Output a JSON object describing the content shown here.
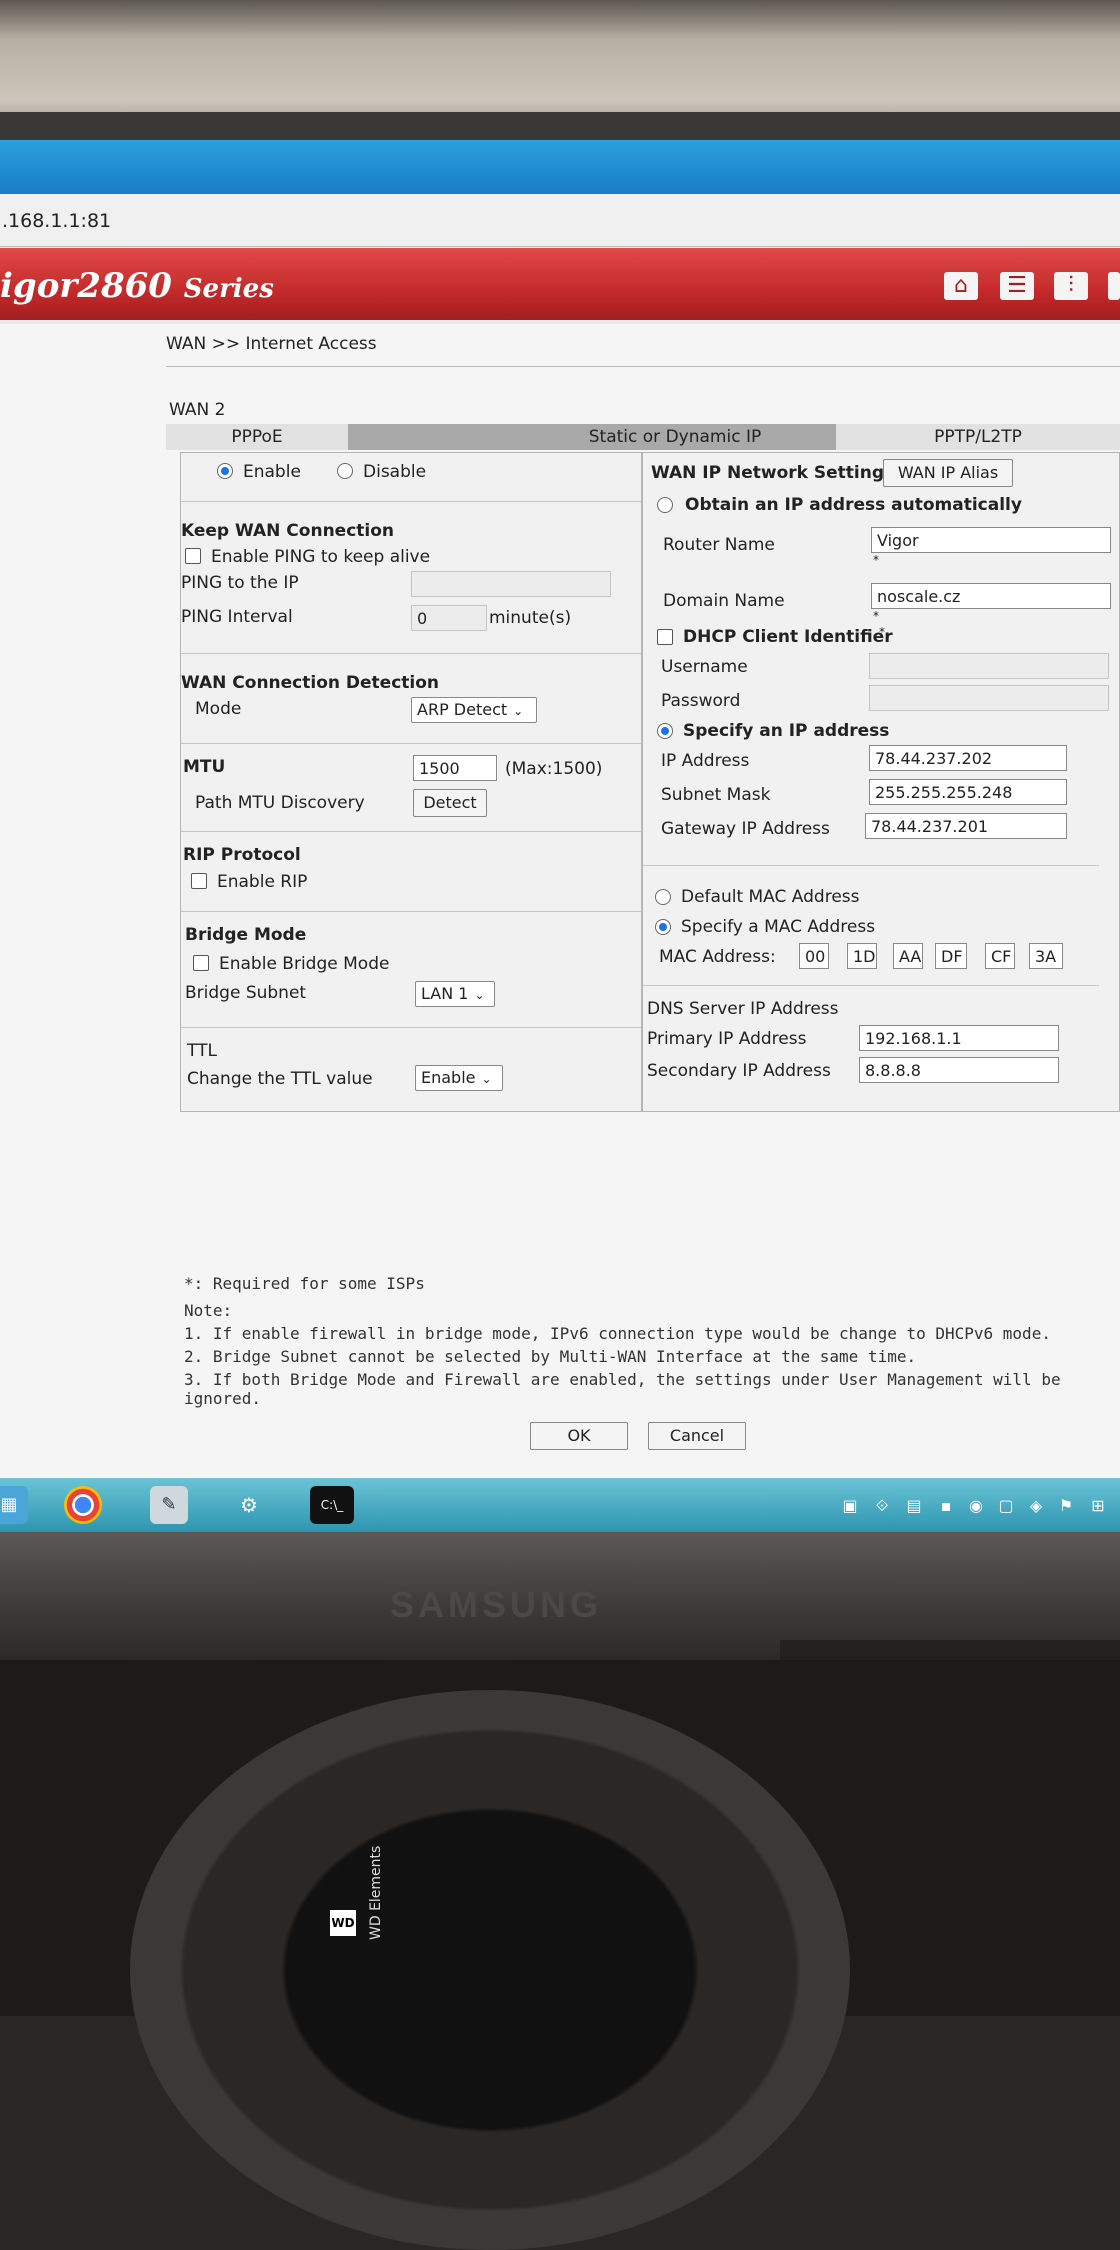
{
  "browser": {
    "url": ".168.1.1:81"
  },
  "header": {
    "brand": "igor2860",
    "series": "Series"
  },
  "breadcrumb": "WAN >> Internet Access",
  "wan_label": "WAN 2",
  "tabs": [
    "PPPoE",
    "Static or Dynamic IP",
    "PPTP/L2TP"
  ],
  "left": {
    "enable": "Enable",
    "disable": "Disable",
    "keep_wan": {
      "title": "Keep WAN Connection",
      "enable_ping": "Enable PING to keep alive",
      "ping_ip_label": "PING to the IP",
      "ping_ip_value": "",
      "ping_interval_label": "PING Interval",
      "ping_interval_value": "0",
      "ping_interval_unit": "minute(s)"
    },
    "detection": {
      "title": "WAN Connection Detection",
      "mode_label": "Mode",
      "mode_value": "ARP Detect"
    },
    "mtu": {
      "title": "MTU",
      "value": "1500",
      "max": "(Max:1500)",
      "path_label": "Path MTU Discovery",
      "detect": "Detect"
    },
    "rip": {
      "title": "RIP Protocol",
      "enable": "Enable RIP"
    },
    "bridge": {
      "title": "Bridge Mode",
      "enable": "Enable Bridge Mode",
      "subnet_label": "Bridge Subnet",
      "subnet_value": "LAN 1"
    },
    "ttl": {
      "title": "TTL",
      "change_label": "Change the TTL value",
      "change_value": "Enable"
    }
  },
  "right": {
    "title": "WAN IP Network Settings",
    "alias_button": "WAN IP Alias",
    "obtain_auto": "Obtain an IP address automatically",
    "router_name_label": "Router Name",
    "router_name_value": "Vigor",
    "domain_name_label": "Domain Name",
    "domain_name_value": "noscale.cz",
    "star": "*",
    "dhcp_client_id": "DHCP Client Identifier",
    "dhcp_star": "*",
    "username_label": "Username",
    "password_label": "Password",
    "specify_ip": "Specify an IP address",
    "ip_label": "IP Address",
    "ip_value": "78.44.237.202",
    "mask_label": "Subnet Mask",
    "mask_value": "255.255.255.248",
    "gateway_label": "Gateway IP Address",
    "gateway_value": "78.44.237.201",
    "default_mac": "Default MAC Address",
    "specify_mac": "Specify a MAC Address",
    "mac_label": "MAC Address:",
    "mac": [
      "00",
      "1D",
      "AA",
      "DF",
      "CF",
      "3A"
    ],
    "dns_title": "DNS Server IP Address",
    "primary_label": "Primary IP Address",
    "primary_value": "192.168.1.1",
    "secondary_label": "Secondary IP Address",
    "secondary_value": "8.8.8.8"
  },
  "notes": {
    "required": "*: Required for some ISPs",
    "note": "Note:",
    "lines": [
      "1. If enable firewall in bridge mode, IPv6 connection type would be change to DHCPv6 mode.",
      "2. Bridge Subnet cannot be selected by Multi-WAN Interface at the same time.",
      "3. If both Bridge Mode and Firewall are enabled, the settings under User Management will be ignored."
    ]
  },
  "buttons": {
    "ok": "OK",
    "cancel": "Cancel"
  },
  "monitor": {
    "brand": "SAMSUNG"
  },
  "drive": {
    "logo": "WD",
    "name": "WD Elements"
  },
  "colors": {
    "header_red": "#c42a2b",
    "taskbar": "#2d95b0",
    "radio_on": "#1a73e8"
  }
}
